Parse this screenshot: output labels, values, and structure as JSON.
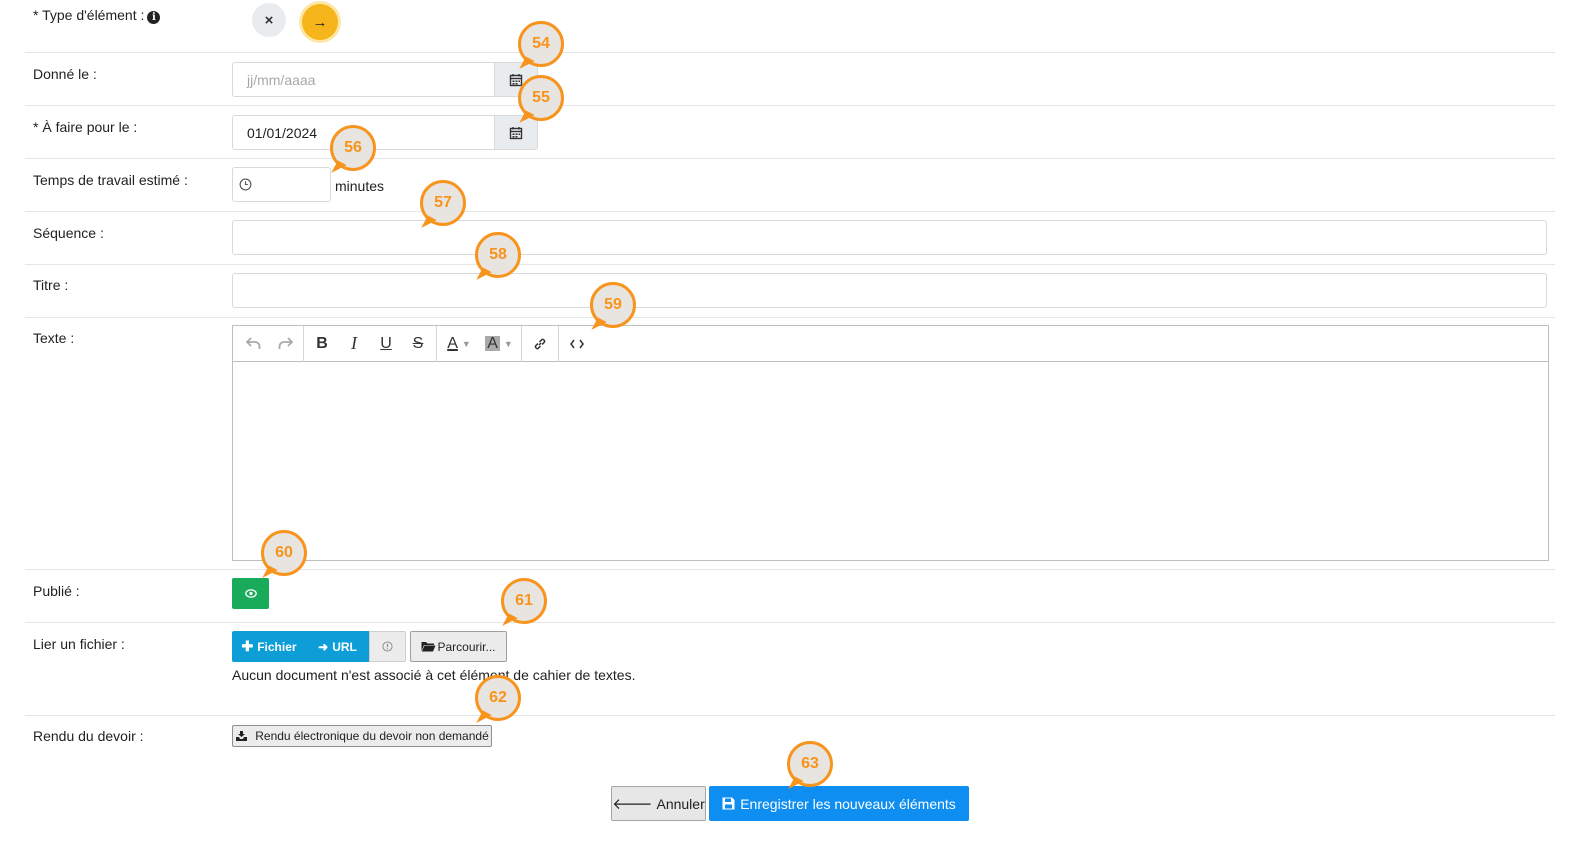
{
  "form": {
    "type_label": "* Type d'élément :",
    "type_options": {
      "cancel_symbol": "×",
      "selected_symbol": "→"
    },
    "given_label": "Donné le :",
    "given_placeholder": "jj/mm/aaaa",
    "due_label": "* À faire pour le :",
    "due_value": "01/01/2024",
    "work_time_label": "Temps de travail estimé :",
    "work_time_unit": "minutes",
    "sequence_label": "Séquence :",
    "title_label": "Titre :",
    "text_label": "Texte :",
    "published_label": "Publié :",
    "link_file_label": "Lier un fichier :",
    "file_button": "Fichier",
    "url_button": "URL",
    "browse_button": "Parcourir...",
    "no_document_text": "Aucun document n'est associé à cet élément de cahier de textes.",
    "homework_submission_label": "Rendu du devoir :",
    "homework_submission_button": "Rendu électronique du devoir non demandé"
  },
  "actions": {
    "cancel_label": "Annuler",
    "save_label": "Enregistrer les nouveaux éléments"
  },
  "markers": [
    "54",
    "55",
    "56",
    "57",
    "58",
    "59",
    "60",
    "61",
    "62",
    "63"
  ],
  "colors": {
    "marker": "#f7941d",
    "type_selected": "#f6b51b",
    "published": "#1aab5a",
    "file_buttons": "#0d9ed8",
    "save": "#0d8ef0"
  },
  "icons": [
    "info-icon",
    "calendar-icon",
    "clock-icon",
    "undo-icon",
    "redo-icon",
    "bold-icon",
    "italic-icon",
    "underline-icon",
    "strikethrough-icon",
    "text-color-icon",
    "highlight-color-icon",
    "link-icon",
    "source-code-icon",
    "eye-icon",
    "plus-icon",
    "share-icon",
    "warning-icon",
    "folder-icon",
    "inbox-icon",
    "arrow-left-icon",
    "save-icon"
  ]
}
